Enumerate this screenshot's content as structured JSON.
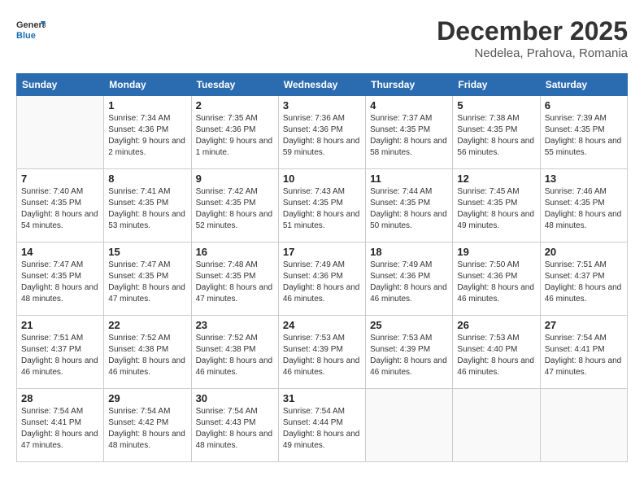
{
  "header": {
    "logo_line1": "General",
    "logo_line2": "Blue",
    "month_year": "December 2025",
    "location": "Nedelea, Prahova, Romania"
  },
  "weekdays": [
    "Sunday",
    "Monday",
    "Tuesday",
    "Wednesday",
    "Thursday",
    "Friday",
    "Saturday"
  ],
  "weeks": [
    [
      null,
      {
        "day": 1,
        "sunrise": "7:34 AM",
        "sunset": "4:36 PM",
        "daylight": "9 hours and 2 minutes."
      },
      {
        "day": 2,
        "sunrise": "7:35 AM",
        "sunset": "4:36 PM",
        "daylight": "9 hours and 1 minute."
      },
      {
        "day": 3,
        "sunrise": "7:36 AM",
        "sunset": "4:36 PM",
        "daylight": "8 hours and 59 minutes."
      },
      {
        "day": 4,
        "sunrise": "7:37 AM",
        "sunset": "4:35 PM",
        "daylight": "8 hours and 58 minutes."
      },
      {
        "day": 5,
        "sunrise": "7:38 AM",
        "sunset": "4:35 PM",
        "daylight": "8 hours and 56 minutes."
      },
      {
        "day": 6,
        "sunrise": "7:39 AM",
        "sunset": "4:35 PM",
        "daylight": "8 hours and 55 minutes."
      }
    ],
    [
      {
        "day": 7,
        "sunrise": "7:40 AM",
        "sunset": "4:35 PM",
        "daylight": "8 hours and 54 minutes."
      },
      {
        "day": 8,
        "sunrise": "7:41 AM",
        "sunset": "4:35 PM",
        "daylight": "8 hours and 53 minutes."
      },
      {
        "day": 9,
        "sunrise": "7:42 AM",
        "sunset": "4:35 PM",
        "daylight": "8 hours and 52 minutes."
      },
      {
        "day": 10,
        "sunrise": "7:43 AM",
        "sunset": "4:35 PM",
        "daylight": "8 hours and 51 minutes."
      },
      {
        "day": 11,
        "sunrise": "7:44 AM",
        "sunset": "4:35 PM",
        "daylight": "8 hours and 50 minutes."
      },
      {
        "day": 12,
        "sunrise": "7:45 AM",
        "sunset": "4:35 PM",
        "daylight": "8 hours and 49 minutes."
      },
      {
        "day": 13,
        "sunrise": "7:46 AM",
        "sunset": "4:35 PM",
        "daylight": "8 hours and 48 minutes."
      }
    ],
    [
      {
        "day": 14,
        "sunrise": "7:47 AM",
        "sunset": "4:35 PM",
        "daylight": "8 hours and 48 minutes."
      },
      {
        "day": 15,
        "sunrise": "7:47 AM",
        "sunset": "4:35 PM",
        "daylight": "8 hours and 47 minutes."
      },
      {
        "day": 16,
        "sunrise": "7:48 AM",
        "sunset": "4:35 PM",
        "daylight": "8 hours and 47 minutes."
      },
      {
        "day": 17,
        "sunrise": "7:49 AM",
        "sunset": "4:36 PM",
        "daylight": "8 hours and 46 minutes."
      },
      {
        "day": 18,
        "sunrise": "7:49 AM",
        "sunset": "4:36 PM",
        "daylight": "8 hours and 46 minutes."
      },
      {
        "day": 19,
        "sunrise": "7:50 AM",
        "sunset": "4:36 PM",
        "daylight": "8 hours and 46 minutes."
      },
      {
        "day": 20,
        "sunrise": "7:51 AM",
        "sunset": "4:37 PM",
        "daylight": "8 hours and 46 minutes."
      }
    ],
    [
      {
        "day": 21,
        "sunrise": "7:51 AM",
        "sunset": "4:37 PM",
        "daylight": "8 hours and 46 minutes."
      },
      {
        "day": 22,
        "sunrise": "7:52 AM",
        "sunset": "4:38 PM",
        "daylight": "8 hours and 46 minutes."
      },
      {
        "day": 23,
        "sunrise": "7:52 AM",
        "sunset": "4:38 PM",
        "daylight": "8 hours and 46 minutes."
      },
      {
        "day": 24,
        "sunrise": "7:53 AM",
        "sunset": "4:39 PM",
        "daylight": "8 hours and 46 minutes."
      },
      {
        "day": 25,
        "sunrise": "7:53 AM",
        "sunset": "4:39 PM",
        "daylight": "8 hours and 46 minutes."
      },
      {
        "day": 26,
        "sunrise": "7:53 AM",
        "sunset": "4:40 PM",
        "daylight": "8 hours and 46 minutes."
      },
      {
        "day": 27,
        "sunrise": "7:54 AM",
        "sunset": "4:41 PM",
        "daylight": "8 hours and 47 minutes."
      }
    ],
    [
      {
        "day": 28,
        "sunrise": "7:54 AM",
        "sunset": "4:41 PM",
        "daylight": "8 hours and 47 minutes."
      },
      {
        "day": 29,
        "sunrise": "7:54 AM",
        "sunset": "4:42 PM",
        "daylight": "8 hours and 48 minutes."
      },
      {
        "day": 30,
        "sunrise": "7:54 AM",
        "sunset": "4:43 PM",
        "daylight": "8 hours and 48 minutes."
      },
      {
        "day": 31,
        "sunrise": "7:54 AM",
        "sunset": "4:44 PM",
        "daylight": "8 hours and 49 minutes."
      },
      null,
      null,
      null
    ]
  ]
}
